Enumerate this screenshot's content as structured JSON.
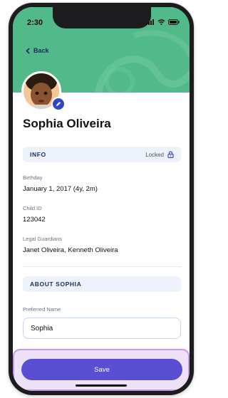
{
  "status_bar": {
    "time": "2:30"
  },
  "header": {
    "back_label": "Back",
    "color": "#52b98a"
  },
  "profile": {
    "name": "Sophia Oliveira"
  },
  "info_section": {
    "title": "INFO",
    "locked_label": "Locked",
    "fields": [
      {
        "label": "Birthday",
        "value": "January 1, 2017 (4y, 2m)"
      },
      {
        "label": "Child ID",
        "value": "123042"
      },
      {
        "label": "Legal Guardians",
        "value": "Janet Oliveira, Kenneth Oliveira"
      }
    ]
  },
  "about_section": {
    "title": "ABOUT SOPHIA",
    "preferred_name_label": "Preferred Name",
    "preferred_name_value": "Sophia"
  },
  "actions": {
    "save_label": "Save",
    "save_color": "#5a4fd3"
  }
}
